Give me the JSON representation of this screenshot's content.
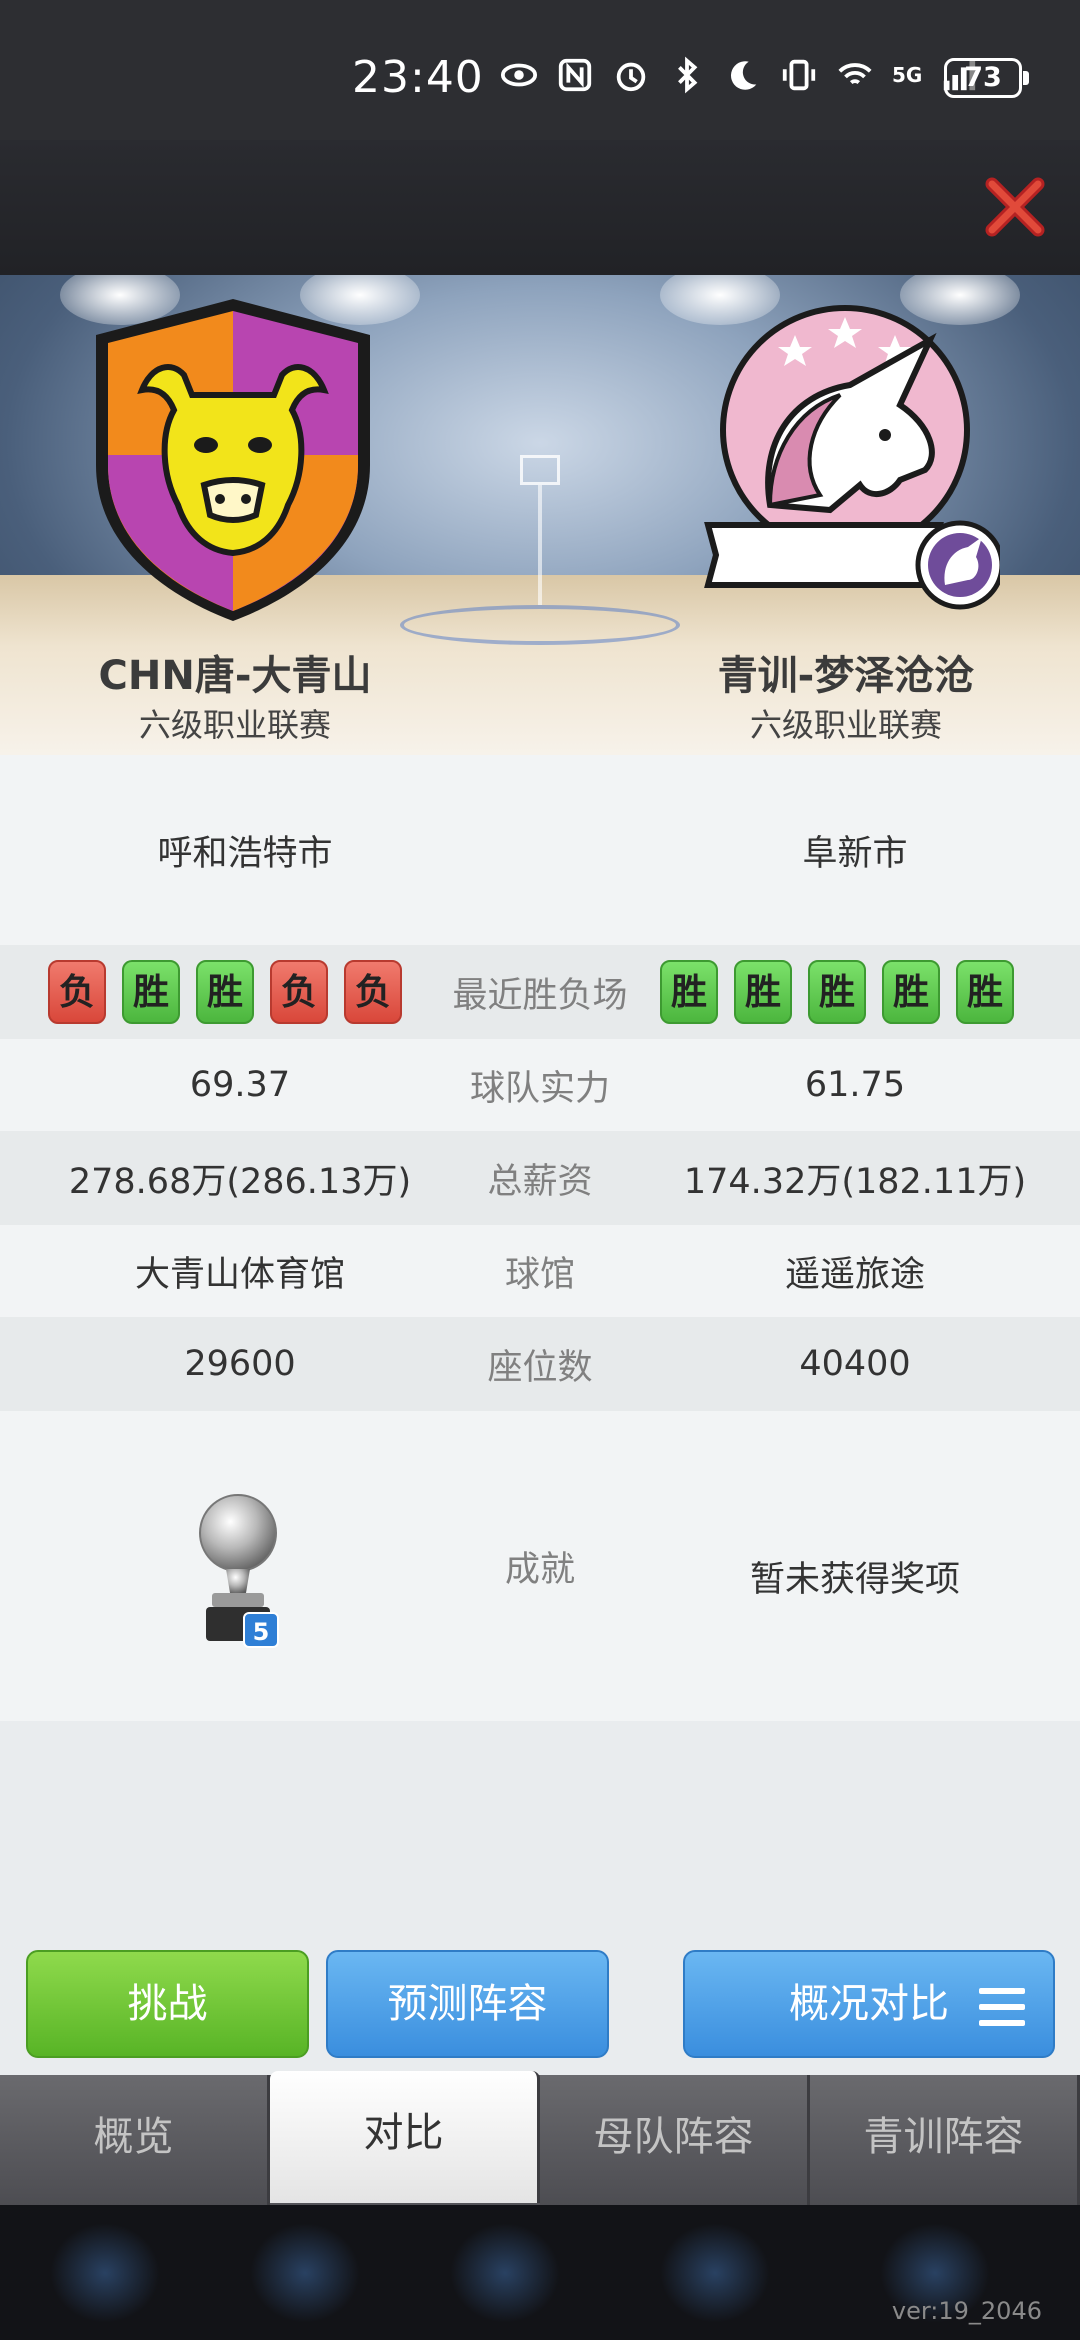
{
  "status_bar": {
    "time": "23:40",
    "network": "5G",
    "battery": "73"
  },
  "left_team": {
    "name": "CHN唐-大青山",
    "league": "六级职业联赛",
    "city": "呼和浩特市",
    "recent": [
      "负",
      "胜",
      "胜",
      "负",
      "负"
    ],
    "strength": "69.37",
    "salary": "278.68万(286.13万)",
    "arena": "大青山体育馆",
    "seats": "29600",
    "achievement_count": "5"
  },
  "right_team": {
    "name": "青训-梦泽沧沧",
    "league": "六级职业联赛",
    "city": "阜新市",
    "recent": [
      "胜",
      "胜",
      "胜",
      "胜",
      "胜"
    ],
    "strength": "61.75",
    "salary": "174.32万(182.11万)",
    "arena": "遥遥旅途",
    "seats": "40400",
    "achievement": "暂未获得奖项"
  },
  "labels": {
    "recent": "最近胜负场",
    "strength": "球队实力",
    "salary": "总薪资",
    "arena": "球馆",
    "seats": "座位数",
    "achievement": "成就"
  },
  "buttons": {
    "challenge": "挑战",
    "predict": "预测阵容",
    "compare": "概况对比"
  },
  "tabs": [
    "概览",
    "对比",
    "母队阵容",
    "青训阵容"
  ],
  "active_tab": "对比",
  "version": "ver:19_2046",
  "colors": {
    "win": "#5ec84a",
    "loss": "#e0574a",
    "green_button": "#6cc335",
    "blue_button": "#4a9fe6"
  }
}
